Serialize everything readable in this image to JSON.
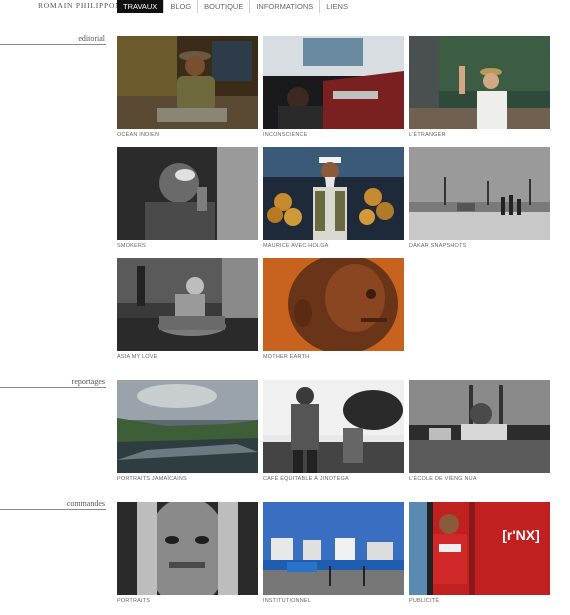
{
  "site": {
    "title": "ROMAIN PHILIPPON"
  },
  "nav": {
    "items": [
      "TRAVAUX",
      "BLOG",
      "BOUTIQUE",
      "INFORMATIONS",
      "LIENS"
    ]
  },
  "sections": [
    {
      "label": "editorial",
      "captions": [
        "OCÉAN INDIEN",
        "INCONSCIENCE",
        "L'ÉTRANGER",
        "SMOKERS",
        "MAURICE AVEC HOLGA",
        "DAKAR SNAPSHOTS",
        "ASIA MY LOVE",
        "MOTHER EARTH"
      ]
    },
    {
      "label": "reportages",
      "captions": [
        "PORTRAITS JAMAÏCAINS",
        "CAFÉ ÉQUITABLE À JINOTEGA",
        "L'ÉCOLE DE VIENG NUA"
      ]
    },
    {
      "label": "commandes",
      "captions": [
        "PORTRAITS",
        "INSTITUTIONNEL",
        "PUBLICITÉ"
      ]
    }
  ],
  "photos": {
    "publicite_sign": "[r'NX]"
  }
}
